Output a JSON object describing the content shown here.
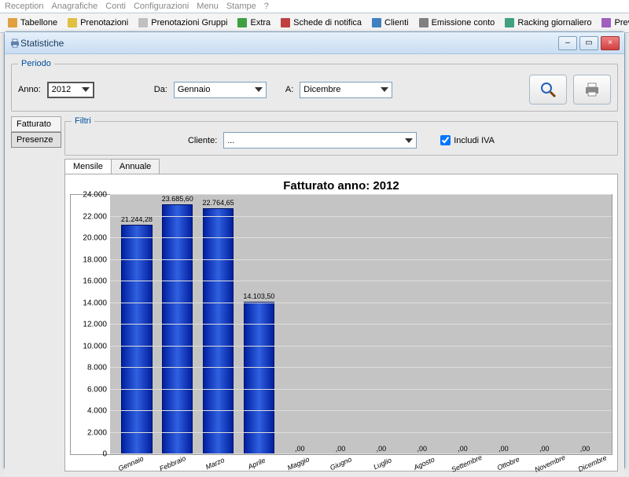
{
  "menubar": [
    "Reception",
    "Anagrafiche",
    "Conti",
    "Configurazioni",
    "Menu",
    "Stampe",
    "?"
  ],
  "toolbar": [
    "Tabellone",
    "Prenotazioni",
    "Prenotazioni Gruppi",
    "Extra",
    "Schede di notifica",
    "Clienti",
    "Emissione conto",
    "Racking giornaliero",
    "Preventivi"
  ],
  "window": {
    "title": "Statistiche",
    "min": "–",
    "max": "▭",
    "close": "×",
    "print_icon": "print-icon"
  },
  "periodo": {
    "legend": "Periodo",
    "anno_label": "Anno:",
    "anno": "2012",
    "da_label": "Da:",
    "da": "Gennaio",
    "a_label": "A:",
    "a": "Dicembre"
  },
  "sidetabs": {
    "fatturato": "Fatturato",
    "presenze": "Presenze"
  },
  "filtri": {
    "legend": "Filtri",
    "cliente_label": "Cliente:",
    "cliente": "...",
    "iva_label": "Includi IVA",
    "iva_checked": true
  },
  "tabs": {
    "mensile": "Mensile",
    "annuale": "Annuale"
  },
  "chart_data": {
    "type": "bar",
    "title": "Fatturato anno: 2012",
    "categories": [
      "Gennaio",
      "Febbraio",
      "Marzo",
      "Aprile",
      "Maggio",
      "Giugno",
      "Luglio",
      "Agosto",
      "Settembre",
      "Ottobre",
      "Novembre",
      "Dicembre"
    ],
    "values": [
      21244.28,
      23685.6,
      22764.65,
      14103.5,
      0,
      0,
      0,
      0,
      0,
      0,
      0,
      0
    ],
    "data_labels": [
      "21.244,28",
      "23.685,60",
      "22.764,65",
      "14.103,50",
      ",00",
      ",00",
      ",00",
      ",00",
      ",00",
      ",00",
      ",00",
      ",00"
    ],
    "ylim": [
      0,
      24000
    ],
    "yticks": [
      0,
      2000,
      4000,
      6000,
      8000,
      10000,
      12000,
      14000,
      16000,
      18000,
      20000,
      22000,
      24000
    ],
    "ytick_labels": [
      "0",
      "2.000",
      "4.000",
      "6.000",
      "8.000",
      "10.000",
      "12.000",
      "14.000",
      "16.000",
      "18.000",
      "20.000",
      "22.000",
      "24.000"
    ],
    "xlabel": "",
    "ylabel": ""
  },
  "icons": {
    "search": "search-icon",
    "print": "print-icon"
  }
}
